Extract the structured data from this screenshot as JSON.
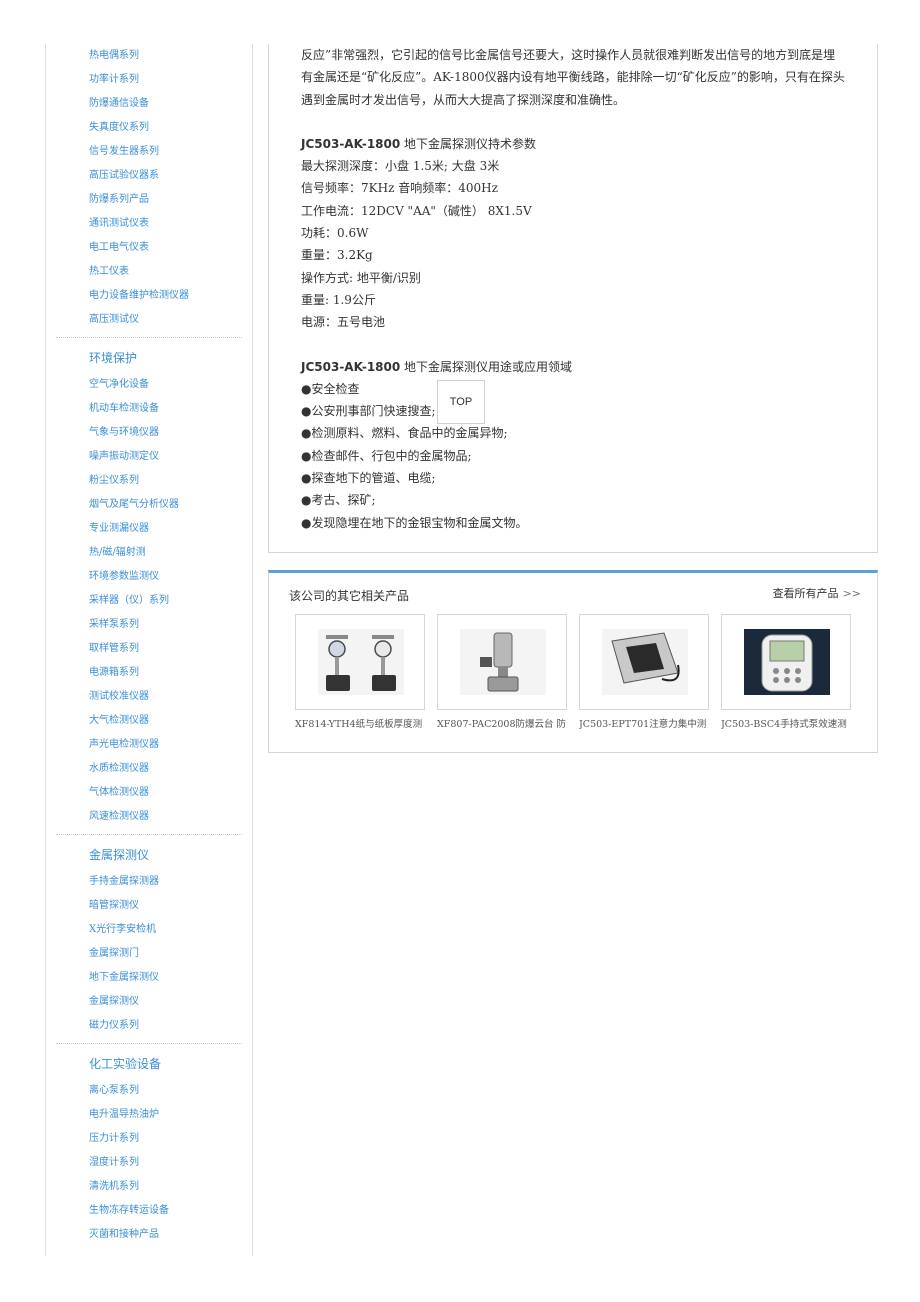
{
  "sidebar": {
    "groups": [
      {
        "heading": "",
        "items": [
          "热电偶系列",
          "功率计系列",
          "防爆通信设备",
          "失真度仪系列",
          "信号发生器系列",
          "高压试验仪器系",
          "防爆系列产品",
          "通讯测试仪表",
          "电工电气仪表",
          "热工仪表",
          "电力设备维护检测仪器",
          "高压测试仪"
        ]
      },
      {
        "heading": "环境保护",
        "items": [
          "空气净化设备",
          "机动车检测设备",
          "气象与环境仪器",
          "噪声振动测定仪",
          "粉尘仪系列",
          "烟气及尾气分析仪器",
          "专业测漏仪器",
          "热/磁/辐射测",
          "环境参数监测仪",
          "采样器（仪）系列",
          "采样泵系列",
          "取样管系列",
          "电源箱系列",
          "测试校准仪器",
          "大气检测仪器",
          "声光电检测仪器",
          "水质检测仪器",
          "气体检测仪器",
          "风速检测仪器"
        ]
      },
      {
        "heading": "金属探测仪",
        "items": [
          "手持金属探测器",
          "暗管探测仪",
          "X光行李安检机",
          "金属探测门",
          "地下金属探测仪",
          "金属探测仪",
          "磁力仪系列"
        ]
      },
      {
        "heading": "化工实验设备",
        "items": [
          "离心泵系列",
          "电升温导热油炉",
          "压力计系列",
          "湿度计系列",
          "清洗机系列",
          "生物冻存转运设备",
          "灭菌和接种产品"
        ]
      }
    ]
  },
  "article": {
    "intro_lines": [
      "反应”非常强烈，它引起的信号比金属信号还要大，这时操作人员就很难判断发出信号的地方到底是埋",
      "有金属还是“矿化反应”。AK-1800仪器内设有地平衡线路，能排除一切“矿化反应”的影响，只有在探头",
      "遇到金属时才发出信号，从而大大提高了探测深度和准确性。"
    ],
    "spec_model": "JC503-AK-1800",
    "spec_title": " 地下金属探测仪持术参数",
    "specs": [
      "最大探测深度：小盘 1.5米; 大盘 3米",
      "信号频率：7KHz 音响频率：400Hz",
      "工作电流：12DCV \"AA\"（碱性） 8X1.5V",
      "功耗：0.6W",
      "重量：3.2Kg",
      "操作方式: 地平衡/识别",
      "重量: 1.9公斤",
      "电源：五号电池"
    ],
    "use_model": "JC503-AK-1800",
    "use_title": " 地下金属探测仪用途或应用领域",
    "uses": [
      "●安全检查",
      "●公安刑事部门快速搜查;",
      "●检测原料、燃料、食品中的金属异物;",
      "●检查邮件、行包中的金属物品;",
      "●探查地下的管道、电缆;",
      "●考古、探矿;",
      "●发现隐埋在地下的金银宝物和金属文物。"
    ],
    "top_label": "TOP"
  },
  "related": {
    "title": "该公司的其它相关产品",
    "more_label": "查看所有产品",
    "more_icon": "double-chevron-right-icon",
    "products": [
      {
        "name": "XF814-YTH4纸与纸板厚度测",
        "icon": "thickness-gauge-image"
      },
      {
        "name": "XF807-PAC2008防爆云台 防",
        "icon": "explosion-proof-pan-tilt-image"
      },
      {
        "name": "JC503-EPT701注意力集中测",
        "icon": "attention-tester-image"
      },
      {
        "name": "JC503-BSC4手持式泵效速测",
        "icon": "handheld-pump-tester-image"
      }
    ]
  }
}
